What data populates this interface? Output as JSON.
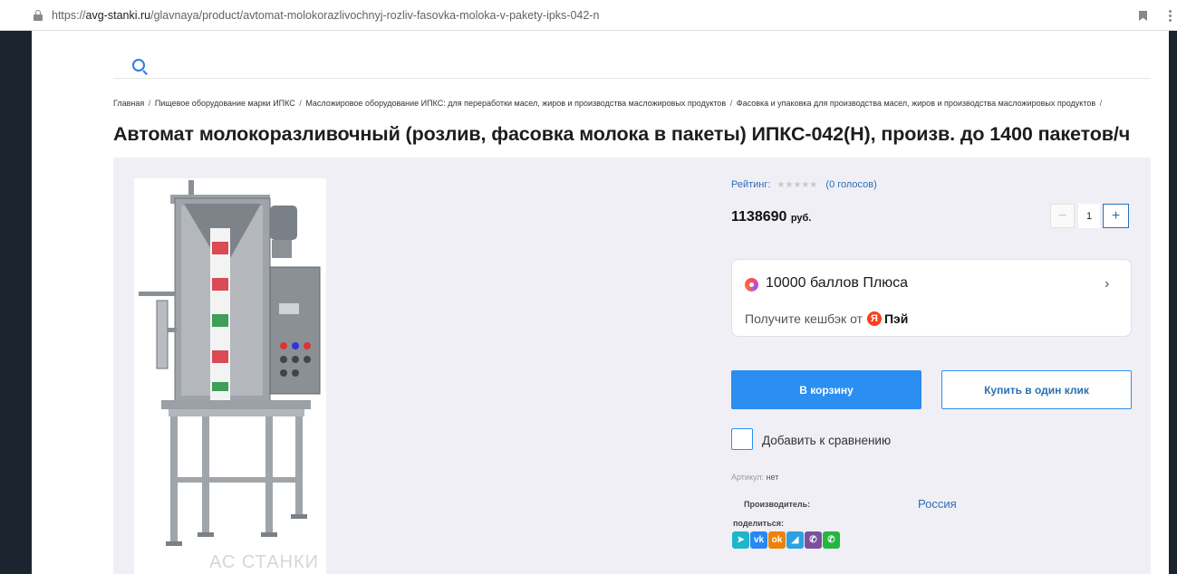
{
  "browser": {
    "url_prefix": "https://",
    "url_domain": "avg-stanki.ru",
    "url_path": "/glavnaya/product/avtomat-molokorazlivochnyj-rozliv-fasovka-moloka-v-pakety-ipks-042-n"
  },
  "breadcrumb": {
    "items": [
      "Главная",
      "Пищевое оборудование марки ИПКС",
      "Масложировое оборудование ИПКС: для переработки масел, жиров и производства масложировых продуктов",
      "Фасовка и упаковка для производства масел, жиров и производства масложировых продуктов"
    ],
    "separator": "/"
  },
  "product": {
    "title": "Автомат молокоразливочный (розлив, фасовка молока в пакеты) ИПКС-042(Н), произв. до 1400 пакетов/ч",
    "watermark": "АС СТАНКИ",
    "rating_label": "Рейтинг:",
    "rating_stars": "★★★★★",
    "rating_value": 0,
    "rating_votes": "(0 голосов)",
    "price": "1138690",
    "currency": "руб.",
    "quantity": "1",
    "qty_minus": "−",
    "qty_plus": "+"
  },
  "plus_card": {
    "title": "10000 баллов Плюса",
    "subtitle": "Получите кешбэк от",
    "pay_icon": "Я",
    "pay_label": "Пэй",
    "chevron": "›"
  },
  "actions": {
    "cart_label": "В корзину",
    "oneclick_label": "Купить в один клик",
    "compare_label": "Добавить к сравнению"
  },
  "details": {
    "sku_label": "Артикул:",
    "sku_value": "нет",
    "maker_label": "Производитель:",
    "maker_value": "Россия",
    "share_label": "поделиться:"
  },
  "share_buttons": [
    {
      "name": "share-telegram-icon",
      "glyph": "➤",
      "color": "#1fb6c9"
    },
    {
      "name": "share-vk-icon",
      "glyph": "vk",
      "color": "#2787f5"
    },
    {
      "name": "share-ok-icon",
      "glyph": "ok",
      "color": "#ee8208"
    },
    {
      "name": "share-telegram2-icon",
      "glyph": "◢",
      "color": "#2aa3e0"
    },
    {
      "name": "share-viber-icon",
      "glyph": "✆",
      "color": "#7b519d"
    },
    {
      "name": "share-whatsapp-icon",
      "glyph": "✆",
      "color": "#25b63f"
    }
  ],
  "colors": {
    "accent": "#2b8ef0",
    "link": "#2b6fb3",
    "panel": "#f1eff6",
    "sidebar": "#1c2430"
  }
}
